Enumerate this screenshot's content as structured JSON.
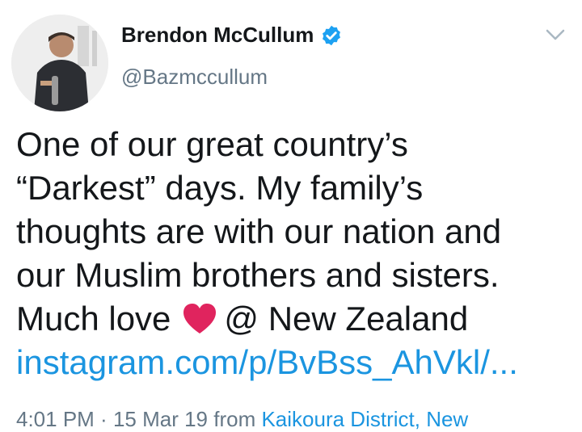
{
  "author": {
    "display_name": "Brendon McCullum",
    "handle": "@Bazmccullum",
    "verified": true
  },
  "tweet": {
    "lines": [
      "One of our great country’s",
      "“Darkest” days. My family’s",
      "thoughts are with our nation and",
      "our Muslim brothers and sisters."
    ],
    "line5_before": "Much love",
    "line5_emoji": "heart-emoji",
    "line5_after": "@ New Zealand",
    "link": "instagram.com/p/BvBss_AhVkl/..."
  },
  "meta": {
    "time": "4:01 PM",
    "separator": " · ",
    "date": "15 Mar 19",
    "from_label": " from ",
    "place": "Kaikoura District, New"
  },
  "colors": {
    "link": "#1b95e0",
    "secondary_text": "#657786",
    "verified_badge": "#1da1f2",
    "heart": "#e0245e"
  }
}
